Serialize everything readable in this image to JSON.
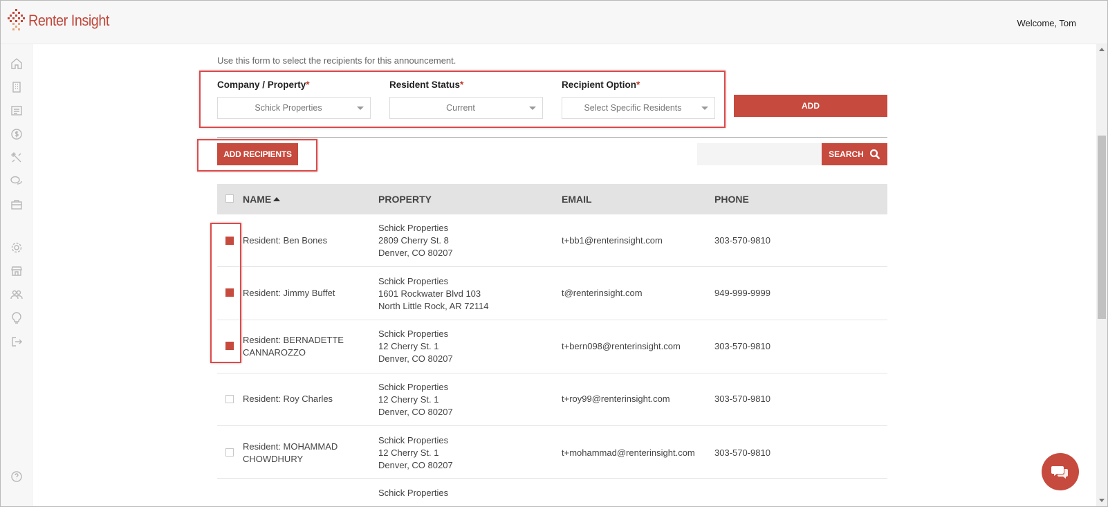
{
  "header": {
    "app_name": "Renter Insight",
    "welcome": "Welcome, Tom"
  },
  "sidebar": {
    "icons": [
      "home-icon",
      "building-icon",
      "list-icon",
      "dollar-icon",
      "tools-icon",
      "chat-icon",
      "briefcase-icon",
      "gear-icon",
      "store-icon",
      "users-icon",
      "lightbulb-icon",
      "logout-icon",
      "help-icon"
    ]
  },
  "form": {
    "intro": "Use this form to select the recipients for this announcement.",
    "company_label": "Company / Property",
    "company_value": "Schick Properties",
    "status_label": "Resident Status",
    "status_value": "Current",
    "option_label": "Recipient Option",
    "option_value": "Select Specific Residents",
    "required_mark": "*",
    "add_label": "ADD"
  },
  "toolbar": {
    "add_recipients_label": "ADD RECIPIENTS",
    "search_label": "SEARCH",
    "search_value": ""
  },
  "table": {
    "headers": {
      "name": "NAME",
      "property": "PROPERTY",
      "email": "EMAIL",
      "phone": "PHONE"
    },
    "rows": [
      {
        "checked": true,
        "name": "Resident: Ben Bones",
        "property": [
          "Schick Properties",
          "2809 Cherry St. 8",
          "Denver, CO 80207"
        ],
        "email": "t+bb1@renterinsight.com",
        "phone": "303-570-9810"
      },
      {
        "checked": true,
        "name": "Resident: Jimmy Buffet",
        "property": [
          "Schick Properties",
          "1601 Rockwater Blvd 103",
          "North Little Rock, AR 72114"
        ],
        "email": "t@renterinsight.com",
        "phone": "949-999-9999"
      },
      {
        "checked": true,
        "name": "Resident: BERNADETTE CANNAROZZO",
        "property": [
          "Schick Properties",
          "12 Cherry St. 1",
          "Denver, CO 80207"
        ],
        "email": "t+bern098@renterinsight.com",
        "phone": "303-570-9810"
      },
      {
        "checked": false,
        "name": "Resident: Roy Charles",
        "property": [
          "Schick Properties",
          "12 Cherry St. 1",
          "Denver, CO 80207"
        ],
        "email": "t+roy99@renterinsight.com",
        "phone": "303-570-9810"
      },
      {
        "checked": false,
        "name": "Resident: MOHAMMAD CHOWDHURY",
        "property": [
          "Schick Properties",
          "12 Cherry St. 1",
          "Denver, CO 80207"
        ],
        "email": "t+mohammad@renterinsight.com",
        "phone": "303-570-9810"
      },
      {
        "checked": false,
        "name": "",
        "property": [
          "Schick Properties",
          "",
          ""
        ],
        "email": "",
        "phone": ""
      }
    ]
  },
  "colors": {
    "accent": "#c64a3d",
    "highlight": "#e04848"
  }
}
